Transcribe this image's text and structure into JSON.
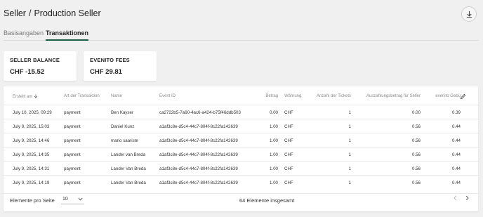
{
  "breadcrumb": {
    "parent": "Seller",
    "separator": "/",
    "current": "Production Seller"
  },
  "tabs": [
    {
      "label": "Basisangaben",
      "active": false
    },
    {
      "label": "Transaktionen",
      "active": true
    }
  ],
  "cards": [
    {
      "label": "SELLER BALANCE",
      "value": "CHF -15.52"
    },
    {
      "label": "EVENITO FEES",
      "value": "CHF 29.81"
    }
  ],
  "table": {
    "headers": {
      "date": "Erstellt am",
      "art": "Art der Transaktion",
      "name": "Name",
      "event": "Event ID",
      "betrag": "Betrag",
      "waehrung": "Währung",
      "anzahl": "Anzahl der Tickets",
      "auszahl": "Auszahlungsbetrag für Seller",
      "fees": "evenito Gebü"
    },
    "sort_icon": "arrow-down-icon",
    "rows": [
      {
        "date": "July 10, 2025, 09:29",
        "art": "payment",
        "name": "Ben Kayser",
        "event": "ca2722b5-7a60-4ac6-a424-b75f46ddb503",
        "betrag": "0.00",
        "waehrung": "CHF",
        "anzahl": "1",
        "auszahl": "0.00",
        "fees": "0.39"
      },
      {
        "date": "July 9, 2025, 15:03",
        "art": "payment",
        "name": "Daniel Kunz",
        "event": "a1af3c8e-d5c4-44c7-804f-8c22fa142639",
        "betrag": "1.00",
        "waehrung": "CHF",
        "anzahl": "1",
        "auszahl": "0.56",
        "fees": "0.44"
      },
      {
        "date": "July 9, 2025, 14:46",
        "art": "payment",
        "name": "mario saariste",
        "event": "a1af3c8e-d5c4-44c7-804f-8c22fa142639",
        "betrag": "1.00",
        "waehrung": "CHF",
        "anzahl": "1",
        "auszahl": "0.56",
        "fees": "0.44"
      },
      {
        "date": "July 9, 2025, 14:35",
        "art": "payment",
        "name": "Lander van Breda",
        "event": "a1af3c8e-d5c4-44c7-804f-8c22fa142639",
        "betrag": "1.00",
        "waehrung": "CHF",
        "anzahl": "1",
        "auszahl": "0.56",
        "fees": "0.44"
      },
      {
        "date": "July 9, 2025, 14:31",
        "art": "payment",
        "name": "Lander Van Breda",
        "event": "a1af3c8e-d5c4-44c7-804f-8c22fa142639",
        "betrag": "1.00",
        "waehrung": "CHF",
        "anzahl": "1",
        "auszahl": "0.56",
        "fees": "0.44"
      },
      {
        "date": "July 9, 2025, 14:19",
        "art": "payment",
        "name": "Lander Van Breda",
        "event": "a1af3c8e-d5c4-44c7-804f-8c22fa142639",
        "betrag": "1.00",
        "waehrung": "CHF",
        "anzahl": "1",
        "auszahl": "0.56",
        "fees": "0.44"
      }
    ]
  },
  "footer": {
    "per_page_label": "Elemente pro Seite",
    "per_page_value": "10",
    "total": "64 Elemente insgesamt"
  },
  "icons": {
    "download": "download-icon",
    "edit": "pencil-icon",
    "prev": "chevron-left-icon",
    "next": "chevron-right-icon"
  },
  "colors": {
    "accent": "#1e5c46"
  }
}
